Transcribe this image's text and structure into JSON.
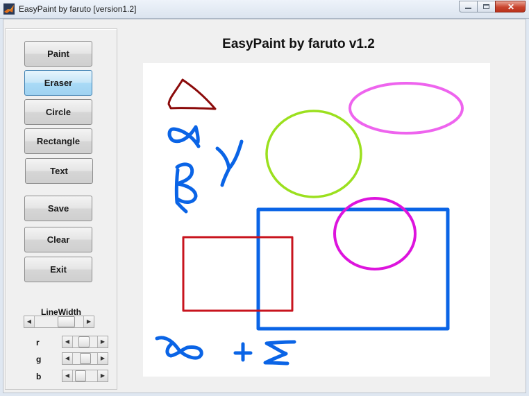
{
  "window": {
    "title": "EasyPaint by faruto [version1.2]",
    "close_glyph": "✕"
  },
  "toolbar": {
    "buttons": [
      {
        "label": "Paint",
        "active": false
      },
      {
        "label": "Eraser",
        "active": true
      },
      {
        "label": "Circle",
        "active": false
      },
      {
        "label": "Rectangle",
        "active": false
      },
      {
        "label": "Text",
        "active": false
      },
      {
        "label": "Save",
        "active": false
      },
      {
        "label": "Clear",
        "active": false
      },
      {
        "label": "Exit",
        "active": false
      }
    ]
  },
  "controls": {
    "linewidth_label": "LineWidth",
    "linewidth_level": 0.72,
    "rgb": [
      {
        "label": "r",
        "level": 0.45
      },
      {
        "label": "g",
        "level": 0.5
      },
      {
        "label": "b",
        "level": 0.2
      }
    ]
  },
  "canvas": {
    "title": "EasyPaint by faruto v1.2"
  },
  "colors": {
    "dark_red": "#8b0a0a",
    "blue": "#0a64e6",
    "lime": "#9be01e",
    "violet": "#ee64ee",
    "magenta": "#dd14dd",
    "red": "#c8141e",
    "active_button": "#a9daf6"
  },
  "icons": {
    "app": "matlab-icon",
    "minimize": "minimize-icon",
    "maximize": "maximize-icon",
    "close": "close-icon",
    "arrow_left": "◀",
    "arrow_right": "▶"
  }
}
